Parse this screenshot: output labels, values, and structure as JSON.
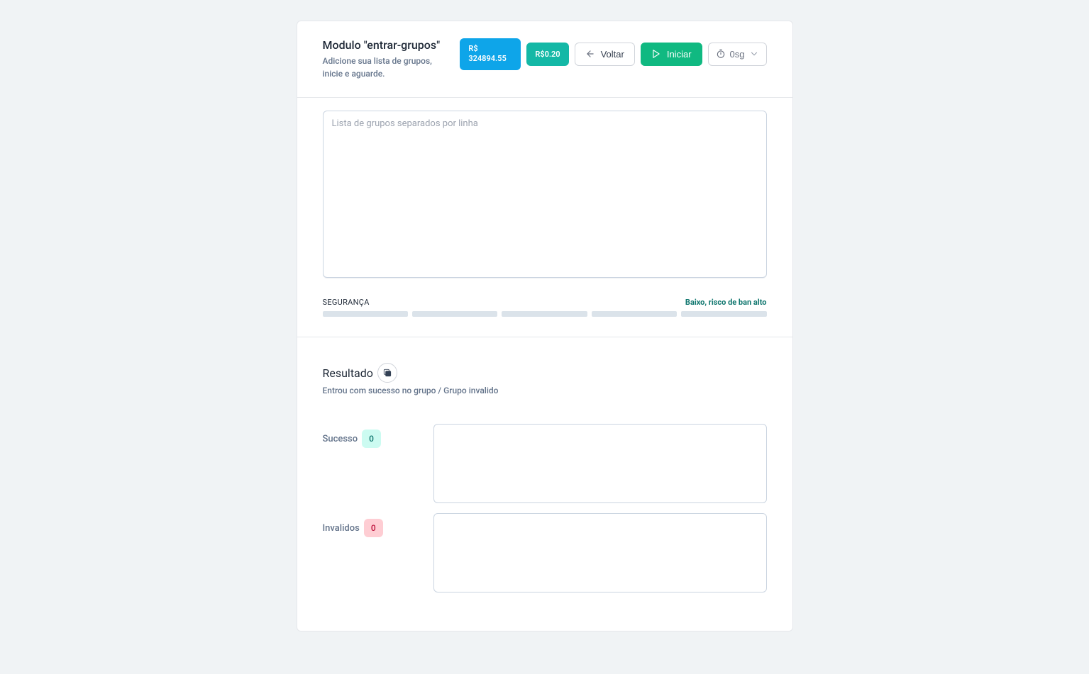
{
  "header": {
    "title": "Modulo \"entrar-grupos\"",
    "subtitle": "Adicione sua lista de grupos, inicie e aguarde.",
    "balance": "R$ 324894.55",
    "price": "R$0.20",
    "back_label": "Voltar",
    "start_label": "Iniciar",
    "timer_select": "0sg"
  },
  "body": {
    "textarea_placeholder": "Lista de grupos separados por linha",
    "textarea_value": "",
    "security_label": "SEGURANÇA",
    "security_value": "Baixo, risco de ban alto"
  },
  "result": {
    "title": "Resultado",
    "subtitle": "Entrou com sucesso no grupo / Grupo invalido",
    "success_label": "Sucesso",
    "success_count": "0",
    "success_content": "",
    "invalid_label": "Invalidos",
    "invalid_count": "0",
    "invalid_content": ""
  }
}
